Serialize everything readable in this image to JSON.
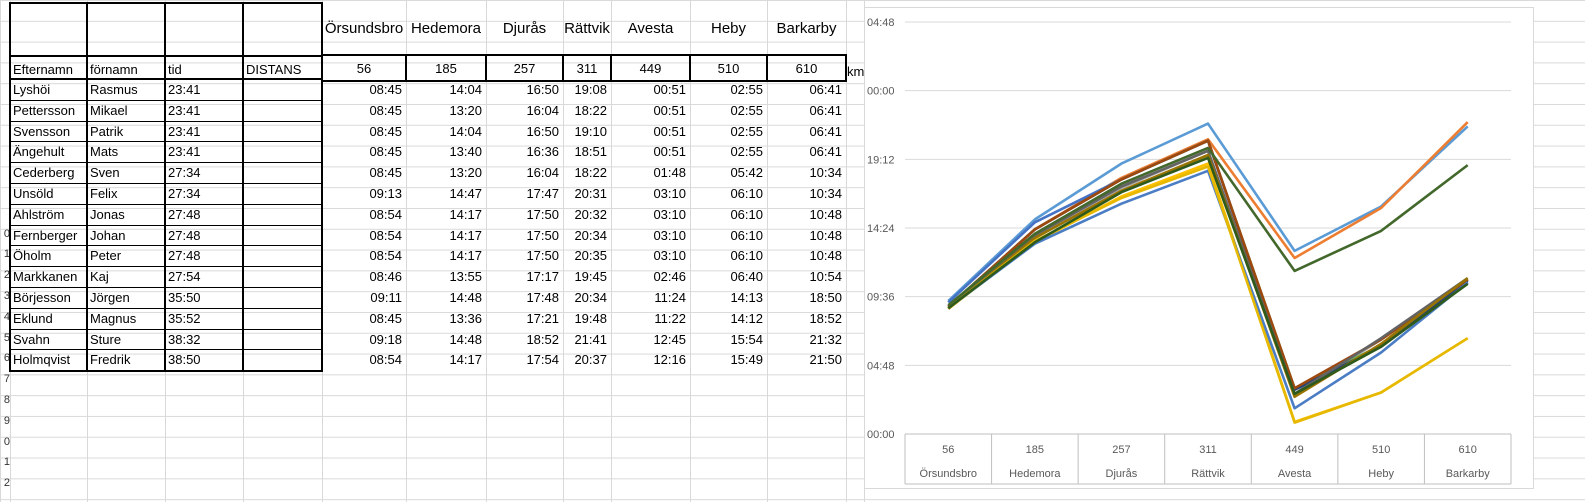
{
  "headers": {
    "efternamn": "Efternamn",
    "fornamn": "förnamn",
    "tid": "tid",
    "distans": "DISTANS",
    "km_unit": "km"
  },
  "cities": [
    "Örsundsbro",
    "Hedemora",
    "Djurås",
    "Rättvik",
    "Avesta",
    "Heby",
    "Barkarby"
  ],
  "distances": [
    "56",
    "185",
    "257",
    "311",
    "449",
    "510",
    "610"
  ],
  "row_numbers": [
    "",
    "",
    "",
    "",
    "",
    "",
    "",
    "",
    "",
    "0",
    "1",
    "2",
    "3",
    "4",
    "5",
    "6",
    "7",
    "8",
    "9",
    "0",
    "1",
    "2"
  ],
  "rows": [
    {
      "efternamn": "Lyshöi",
      "fornamn": "Rasmus",
      "tid": "23:41",
      "times": [
        "08:45",
        "14:04",
        "16:50",
        "19:08",
        "00:51",
        "02:55",
        "06:41"
      ]
    },
    {
      "efternamn": "Pettersson",
      "fornamn": "Mikael",
      "tid": "23:41",
      "times": [
        "08:45",
        "13:20",
        "16:04",
        "18:22",
        "00:51",
        "02:55",
        "06:41"
      ]
    },
    {
      "efternamn": "Svensson",
      "fornamn": "Patrik",
      "tid": "23:41",
      "times": [
        "08:45",
        "14:04",
        "16:50",
        "19:10",
        "00:51",
        "02:55",
        "06:41"
      ]
    },
    {
      "efternamn": "Ängehult",
      "fornamn": "Mats",
      "tid": "23:41",
      "times": [
        "08:45",
        "13:40",
        "16:36",
        "18:51",
        "00:51",
        "02:55",
        "06:41"
      ]
    },
    {
      "efternamn": "Cederberg",
      "fornamn": "Sven",
      "tid": "27:34",
      "times": [
        "08:45",
        "13:20",
        "16:04",
        "18:22",
        "01:48",
        "05:42",
        "10:34"
      ]
    },
    {
      "efternamn": "Unsöld",
      "fornamn": "Felix",
      "tid": "27:34",
      "times": [
        "09:13",
        "14:47",
        "17:47",
        "20:31",
        "03:10",
        "06:10",
        "10:34"
      ]
    },
    {
      "efternamn": "Ahlström",
      "fornamn": "Jonas",
      "tid": "27:48",
      "times": [
        "08:54",
        "14:17",
        "17:50",
        "20:32",
        "03:10",
        "06:10",
        "10:48"
      ]
    },
    {
      "efternamn": "Fernberger",
      "fornamn": "Johan",
      "tid": "27:48",
      "times": [
        "08:54",
        "14:17",
        "17:50",
        "20:34",
        "03:10",
        "06:10",
        "10:48"
      ]
    },
    {
      "efternamn": "Öholm",
      "fornamn": "Peter",
      "tid": "27:48",
      "times": [
        "08:54",
        "14:17",
        "17:50",
        "20:35",
        "03:10",
        "06:10",
        "10:48"
      ]
    },
    {
      "efternamn": "Markkanen",
      "fornamn": "Kaj",
      "tid": "27:54",
      "times": [
        "08:46",
        "13:55",
        "17:17",
        "19:45",
        "02:46",
        "06:40",
        "10:54"
      ]
    },
    {
      "efternamn": "Börjesson",
      "fornamn": "Jörgen",
      "tid": "35:50",
      "times": [
        "09:11",
        "14:48",
        "17:48",
        "20:34",
        "11:24",
        "14:13",
        "18:50"
      ]
    },
    {
      "efternamn": "Eklund",
      "fornamn": "Magnus",
      "tid": "35:52",
      "times": [
        "08:45",
        "13:36",
        "17:21",
        "19:48",
        "11:22",
        "14:12",
        "18:52"
      ]
    },
    {
      "efternamn": "Svahn",
      "fornamn": "Sture",
      "tid": "38:32",
      "times": [
        "09:18",
        "14:48",
        "18:52",
        "21:41",
        "12:45",
        "15:54",
        "21:32"
      ]
    },
    {
      "efternamn": "Holmqvist",
      "fornamn": "Fredrik",
      "tid": "38:50",
      "times": [
        "08:54",
        "14:17",
        "17:54",
        "20:37",
        "12:16",
        "15:49",
        "21:50"
      ]
    }
  ],
  "chart_data": {
    "type": "line",
    "categories": [
      "56",
      "185",
      "257",
      "311",
      "449",
      "510",
      "610"
    ],
    "category_labels": [
      "Örsundsbro",
      "Hedemora",
      "Djurås",
      "Rättvik",
      "Avesta",
      "Heby",
      "Barkarby"
    ],
    "y_tick_labels": [
      "04:48",
      "00:00",
      "19:12",
      "14:24",
      "09:36",
      "04:48",
      "00:00"
    ],
    "ylim_hours": [
      0,
      28.8
    ],
    "grid": true,
    "series": [
      {
        "color": "#5b9bd5",
        "values": [
          9.3,
          15.0,
          18.9,
          21.7,
          12.8,
          15.9,
          21.5
        ]
      },
      {
        "color": "#ed7d31",
        "values": [
          8.9,
          14.3,
          17.9,
          20.6,
          12.3,
          15.8,
          21.8
        ]
      },
      {
        "color": "#a5a5a5",
        "values": [
          8.75,
          13.9,
          17.2,
          19.8,
          2.8,
          6.6,
          10.8
        ]
      },
      {
        "color": "#ffc000",
        "values": [
          8.75,
          13.4,
          16.6,
          18.9,
          0.85,
          2.9,
          6.7
        ]
      },
      {
        "color": "#4472c4",
        "values": [
          9.2,
          14.8,
          17.8,
          20.5,
          3.1,
          6.1,
          10.6
        ]
      },
      {
        "color": "#70ad47",
        "values": [
          8.9,
          14.3,
          17.8,
          20.5,
          3.2,
          6.2,
          10.8
        ]
      },
      {
        "color": "#264478",
        "values": [
          8.9,
          14.3,
          17.8,
          20.5,
          3.1,
          6.1,
          10.7
        ]
      },
      {
        "color": "#9e480e",
        "values": [
          8.9,
          14.3,
          17.8,
          20.5,
          3.2,
          6.6,
          10.8
        ]
      },
      {
        "color": "#636363",
        "values": [
          8.8,
          13.9,
          17.3,
          19.8,
          2.8,
          6.7,
          10.9
        ]
      },
      {
        "color": "#997300",
        "values": [
          8.75,
          13.7,
          17.0,
          19.5,
          2.6,
          6.3,
          10.9
        ]
      },
      {
        "color": "#43682b",
        "values": [
          9.0,
          14.0,
          17.5,
          20.0,
          11.4,
          14.2,
          18.8
        ]
      },
      {
        "color": "#4a7dc4",
        "values": [
          8.8,
          13.3,
          16.1,
          18.4,
          1.8,
          5.7,
          10.6
        ]
      },
      {
        "color": "#e6b800",
        "values": [
          8.8,
          13.5,
          16.5,
          18.7,
          0.8,
          2.9,
          6.7
        ]
      },
      {
        "color": "#2e5a1c",
        "values": [
          8.8,
          13.4,
          16.9,
          19.3,
          2.8,
          6.1,
          10.5
        ]
      }
    ]
  }
}
